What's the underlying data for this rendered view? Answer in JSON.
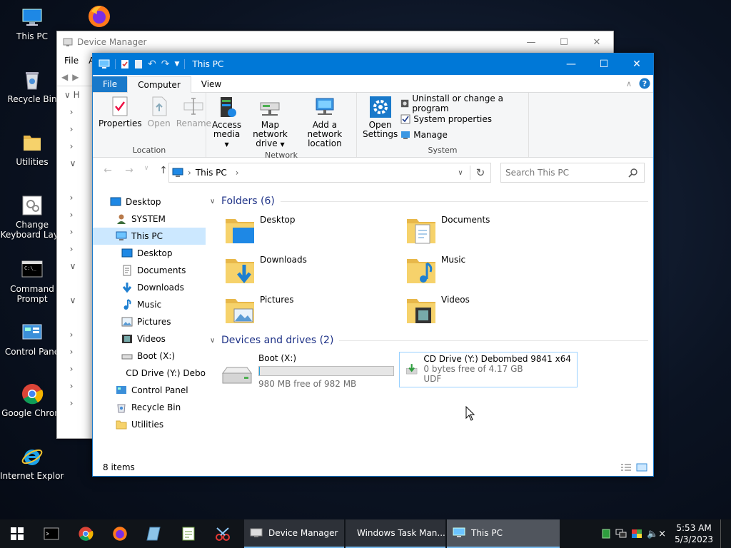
{
  "desktop": {
    "icons": [
      {
        "label": "This PC"
      },
      {
        "label": "Recycle Bin"
      },
      {
        "label": "Utilities"
      },
      {
        "label": "Change Keyboard Layo"
      },
      {
        "label": "Command Prompt"
      },
      {
        "label": "Control Pane"
      },
      {
        "label": "Google Chrom"
      },
      {
        "label": "Internet Explorer"
      }
    ]
  },
  "devmgr": {
    "title": "Device Manager",
    "menu": [
      "File",
      "A"
    ],
    "tree_first": "H"
  },
  "explorer": {
    "title": "This PC",
    "tabs": {
      "file": "File",
      "computer": "Computer",
      "view": "View"
    },
    "ribbon": {
      "location": {
        "name": "Location",
        "properties": "Properties",
        "open": "Open",
        "rename": "Rename"
      },
      "network": {
        "name": "Network",
        "access_media_1": "Access",
        "access_media_2": "media",
        "map_drive_1": "Map network",
        "map_drive_2": "drive",
        "add_loc_1": "Add a network",
        "add_loc_2": "location"
      },
      "system": {
        "name": "System",
        "open_settings_1": "Open",
        "open_settings_2": "Settings",
        "uninstall": "Uninstall or change a program",
        "sysprops": "System properties",
        "manage": "Manage"
      }
    },
    "address": {
      "path": "This PC",
      "search_placeholder": "Search This PC"
    },
    "nav": [
      {
        "label": "Desktop"
      },
      {
        "label": "SYSTEM"
      },
      {
        "label": "This PC"
      },
      {
        "label": "Desktop"
      },
      {
        "label": "Documents"
      },
      {
        "label": "Downloads"
      },
      {
        "label": "Music"
      },
      {
        "label": "Pictures"
      },
      {
        "label": "Videos"
      },
      {
        "label": "Boot (X:)"
      },
      {
        "label": "CD Drive (Y:) Debo"
      },
      {
        "label": "Control Panel"
      },
      {
        "label": "Recycle Bin"
      },
      {
        "label": "Utilities"
      }
    ],
    "folders_header": "Folders (6)",
    "folders": [
      {
        "label": "Desktop"
      },
      {
        "label": "Documents"
      },
      {
        "label": "Downloads"
      },
      {
        "label": "Music"
      },
      {
        "label": "Pictures"
      },
      {
        "label": "Videos"
      }
    ],
    "drives_header": "Devices and drives (2)",
    "drives": [
      {
        "name": "Boot (X:)",
        "detail": "980 MB free of 982 MB",
        "used_fraction": 0.002
      },
      {
        "name": "CD Drive (Y:) Debombed 9841 x64",
        "detail": "0 bytes free of 4.17 GB",
        "fs": "UDF"
      }
    ],
    "status": "8 items"
  },
  "taskbar": {
    "windows": [
      {
        "label": "Device Manager"
      },
      {
        "label": "Windows Task Man..."
      },
      {
        "label": "This PC"
      }
    ],
    "time": "5:53 AM",
    "date": "5/3/2023"
  },
  "colors": {
    "accent": "#0078d7",
    "selection": "#cce8ff",
    "section_header": "#1e3287"
  }
}
